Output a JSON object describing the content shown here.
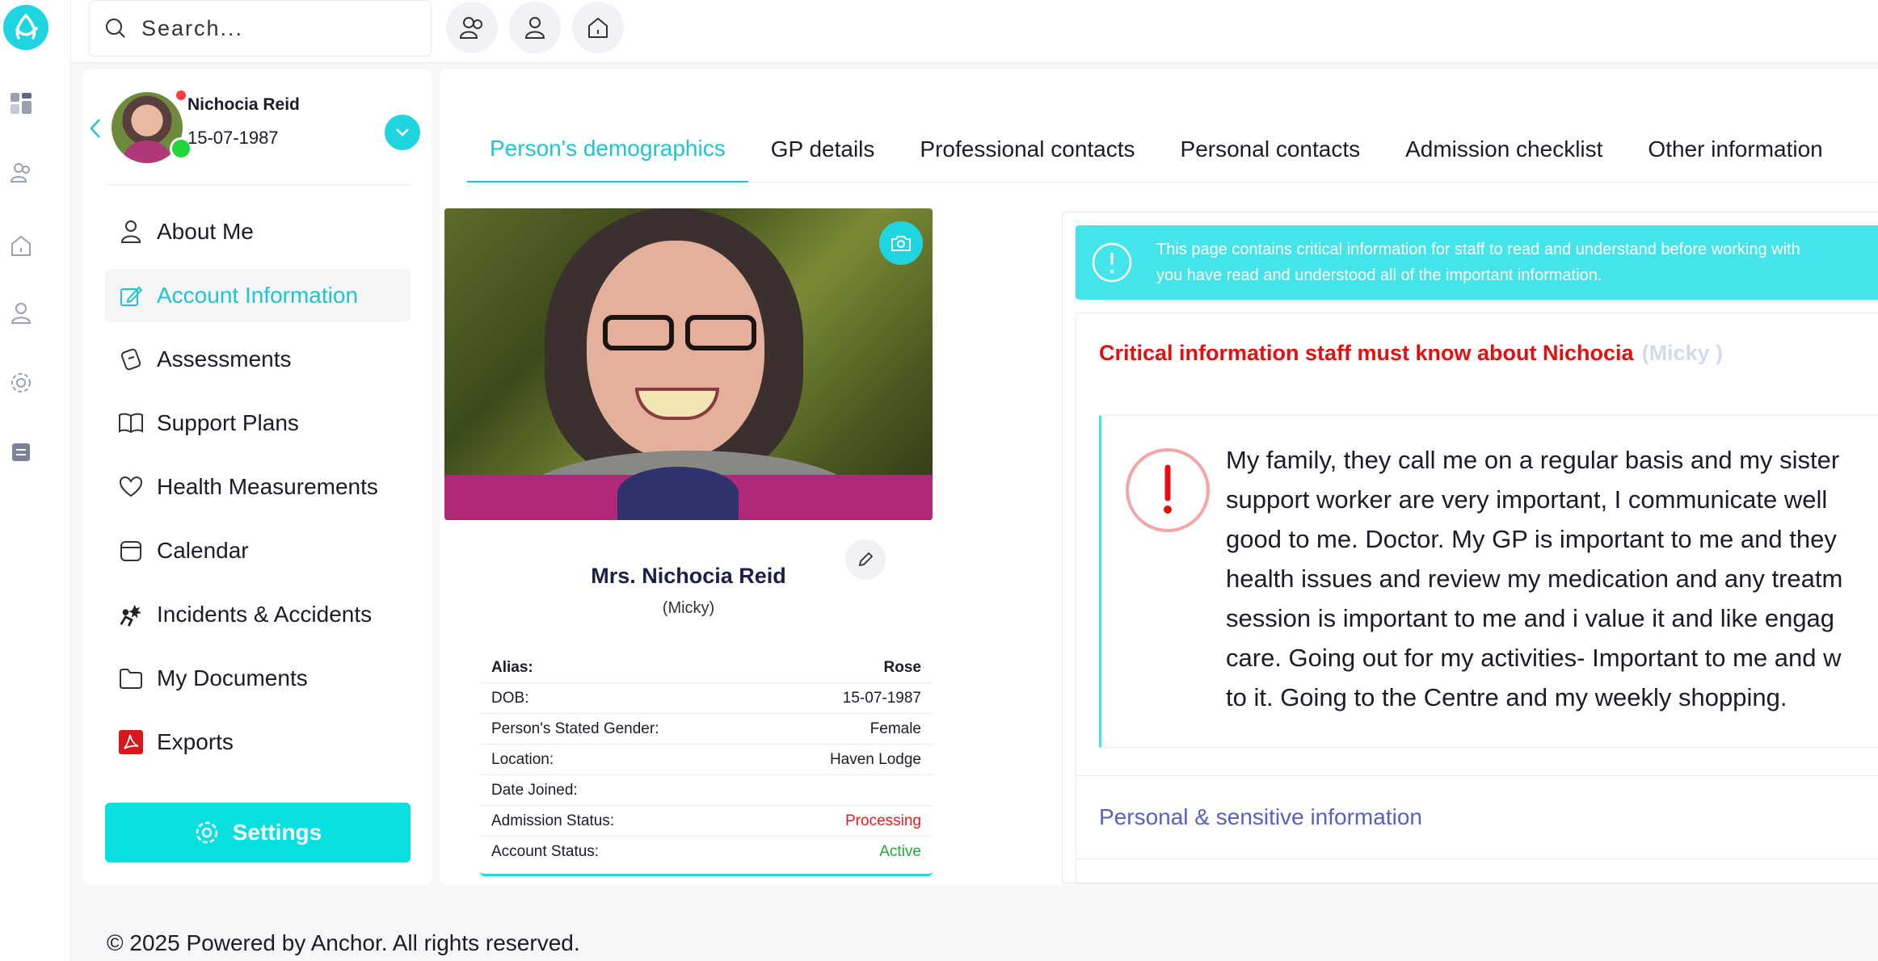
{
  "search": {
    "placeholder": "Search..."
  },
  "profile": {
    "name": "Nichocia Reid",
    "dob": "15-07-1987"
  },
  "menu": [
    {
      "label": "About Me",
      "icon": "user-icon"
    },
    {
      "label": "Account Information",
      "icon": "edit-icon"
    },
    {
      "label": "Assessments",
      "icon": "assessment-icon"
    },
    {
      "label": "Support Plans",
      "icon": "book-icon"
    },
    {
      "label": "Health Measurements",
      "icon": "heart-icon"
    },
    {
      "label": "Calendar",
      "icon": "calendar-icon"
    },
    {
      "label": "Incidents & Accidents",
      "icon": "incident-icon"
    },
    {
      "label": "My Documents",
      "icon": "folder-icon"
    },
    {
      "label": "Exports",
      "icon": "pdf-icon"
    }
  ],
  "settings_label": "Settings",
  "tabs": [
    {
      "label": "Person's demographics"
    },
    {
      "label": "GP details"
    },
    {
      "label": "Professional contacts"
    },
    {
      "label": "Personal contacts"
    },
    {
      "label": "Admission checklist"
    },
    {
      "label": "Other information"
    }
  ],
  "person": {
    "full_name": "Mrs. Nichocia Reid",
    "nickname": "(Micky)",
    "details": [
      {
        "key": "Alias:",
        "value": "Rose"
      },
      {
        "key": "DOB:",
        "value": "15-07-1987"
      },
      {
        "key": "Person's Stated Gender:",
        "value": "Female"
      },
      {
        "key": "Location:",
        "value": "Haven Lodge"
      },
      {
        "key": "Date Joined:",
        "value": ""
      },
      {
        "key": "Admission Status:",
        "value": "Processing"
      },
      {
        "key": "Account Status:",
        "value": "Active"
      }
    ]
  },
  "alert": {
    "line1": "This page contains critical information for staff to read and understand before working with",
    "line2": "you have read and understood all of the important information."
  },
  "critical": {
    "title": "Critical information staff must know about Nichocia",
    "nickname": "(Micky )",
    "lines": [
      "My family, they call me on a regular basis and my sister",
      "support worker are very important, I communicate well",
      "good to me. Doctor. My GP is important to me and they",
      "health issues and review my medication and any treatm",
      "session is important to me and i value it and like engag",
      "care. Going out for my activities- Important to me and w",
      "to it. Going to the Centre and my weekly shopping."
    ]
  },
  "sensitive_label": "Personal & sensitive information",
  "footer": "© 2025 Powered by Anchor. All rights reserved.",
  "colors": {
    "accent": "#1fd6e0",
    "danger": "#e60f0f",
    "success": "#22a83a",
    "link": "#5a5fc2"
  }
}
